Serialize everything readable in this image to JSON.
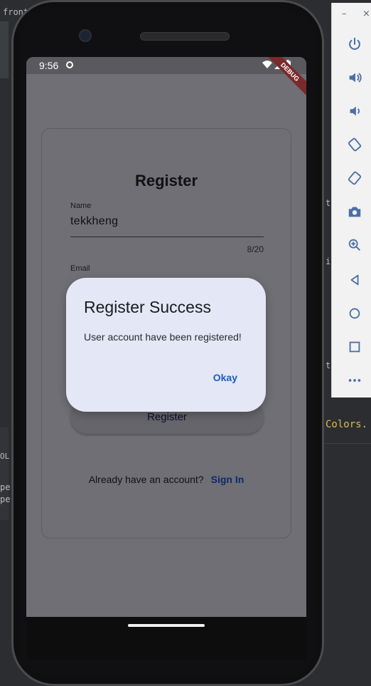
{
  "ide": {
    "top_left_text": "fronte",
    "right_snippet_1": "t",
    "right_snippet_2": "i",
    "right_snippet_3": "t",
    "right_snippet_4": "Colors.",
    "left_snippet_1": "OL",
    "left_snippet_2": "pe",
    "left_snippet_3": "pe"
  },
  "emulator": {
    "min_label": "–",
    "close_label": "×",
    "controls": [
      {
        "name": "power-icon"
      },
      {
        "name": "volume-up-icon"
      },
      {
        "name": "volume-down-icon"
      },
      {
        "name": "rotate-left-icon"
      },
      {
        "name": "rotate-right-icon"
      },
      {
        "name": "camera-icon"
      },
      {
        "name": "zoom-icon"
      },
      {
        "name": "back-icon"
      },
      {
        "name": "home-icon"
      },
      {
        "name": "overview-icon"
      },
      {
        "name": "more-icon"
      }
    ]
  },
  "statusbar": {
    "time": "9:56",
    "debug_label": "DEBUG"
  },
  "form": {
    "title": "Register",
    "name_label": "Name",
    "name_value": "tekkheng",
    "name_counter": "8/20",
    "email_label": "Email",
    "register_button": "Register",
    "have_account_text": "Already have an account?",
    "sign_in_link": "Sign In"
  },
  "dialog": {
    "title": "Register Success",
    "message": "User account have been registered!",
    "ok_label": "Okay"
  },
  "colors": {
    "dialog_bg": "#e3e7f6",
    "accent": "#1d5bbf",
    "scrim": "#6f6f75"
  }
}
